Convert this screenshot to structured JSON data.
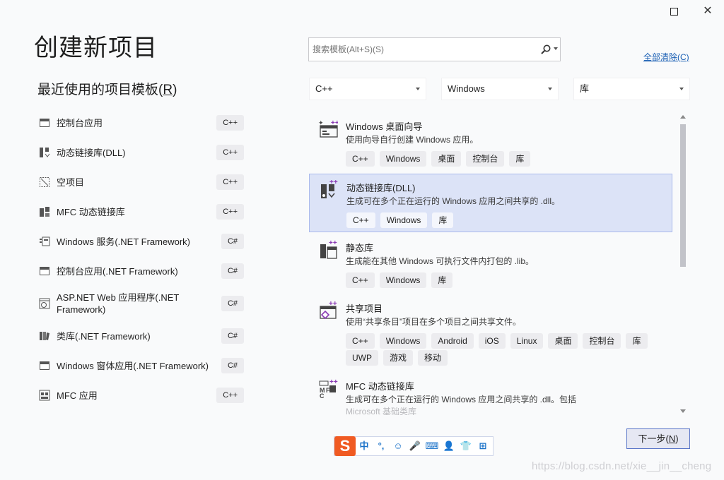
{
  "window": {
    "maximize_icon": "maximize-icon",
    "close_icon": "close-icon",
    "close_glyph": "✕"
  },
  "page_title": "创建新项目",
  "recent": {
    "title": "最近使用的项目模板",
    "title_key": "R",
    "items": [
      {
        "label": "控制台应用",
        "tag": "C++",
        "icon": "console-app-icon"
      },
      {
        "label": "动态链接库(DLL)",
        "tag": "C++",
        "icon": "dll-icon"
      },
      {
        "label": "空项目",
        "tag": "C++",
        "icon": "empty-project-icon"
      },
      {
        "label": "MFC 动态链接库",
        "tag": "C++",
        "icon": "mfc-dll-icon"
      },
      {
        "label": "Windows 服务(.NET Framework)",
        "tag": "C#",
        "icon": "windows-service-icon"
      },
      {
        "label": "控制台应用(.NET Framework)",
        "tag": "C#",
        "icon": "console-app-icon"
      },
      {
        "label": "ASP.NET Web 应用程序(.NET Framework)",
        "tag": "C#",
        "icon": "web-app-icon"
      },
      {
        "label": "类库(.NET Framework)",
        "tag": "C#",
        "icon": "class-library-icon"
      },
      {
        "label": "Windows 窗体应用(.NET Framework)",
        "tag": "C#",
        "icon": "windows-forms-icon"
      },
      {
        "label": "MFC 应用",
        "tag": "C++",
        "icon": "mfc-app-icon"
      }
    ]
  },
  "search": {
    "placeholder": "搜索模板(Alt+S)(S)",
    "icon": "search-icon"
  },
  "clear_all": "全部清除(C)",
  "filters": {
    "language": "C++",
    "platform": "Windows",
    "project_type": "库"
  },
  "templates": [
    {
      "name": "Windows 桌面向导",
      "desc": "使用向导自行创建 Windows 应用。",
      "tags": [
        "C++",
        "Windows",
        "桌面",
        "控制台",
        "库"
      ],
      "icon": "desktop-wizard-icon"
    },
    {
      "name": "动态链接库(DLL)",
      "desc": "生成可在多个正在运行的 Windows 应用之间共享的 .dll。",
      "tags": [
        "C++",
        "Windows",
        "库"
      ],
      "icon": "dll-icon",
      "selected": true
    },
    {
      "name": "静态库",
      "desc": "生成能在其他 Windows 可执行文件内打包的 .lib。",
      "tags": [
        "C++",
        "Windows",
        "库"
      ],
      "icon": "static-library-icon"
    },
    {
      "name": "共享项目",
      "desc": "使用“共享条目”项目在多个项目之间共享文件。",
      "tags": [
        "C++",
        "Windows",
        "Android",
        "iOS",
        "Linux",
        "桌面",
        "控制台",
        "库",
        "UWP",
        "游戏",
        "移动"
      ],
      "icon": "shared-project-icon"
    },
    {
      "name": "MFC 动态链接库",
      "desc": "生成可在多个正在运行的 Windows 应用之间共享的 .dll。包括",
      "desc2": "Microsoft 基础类库",
      "tags": [],
      "icon": "mfc-dll-icon"
    }
  ],
  "next_button": {
    "label": "下一步",
    "key": "N"
  },
  "ime": {
    "logo": "S",
    "items": [
      "中",
      "°,",
      "☺",
      "🎤",
      "⌨",
      "👤",
      "👕",
      "⊞"
    ]
  },
  "watermark": "https://blog.csdn.net/xie__jin__cheng",
  "colors": {
    "accent": "#1a5fb4",
    "selected_bg": "#dce3f7",
    "selected_border": "#a9b9ec",
    "ime_logo": "#f05a22"
  }
}
